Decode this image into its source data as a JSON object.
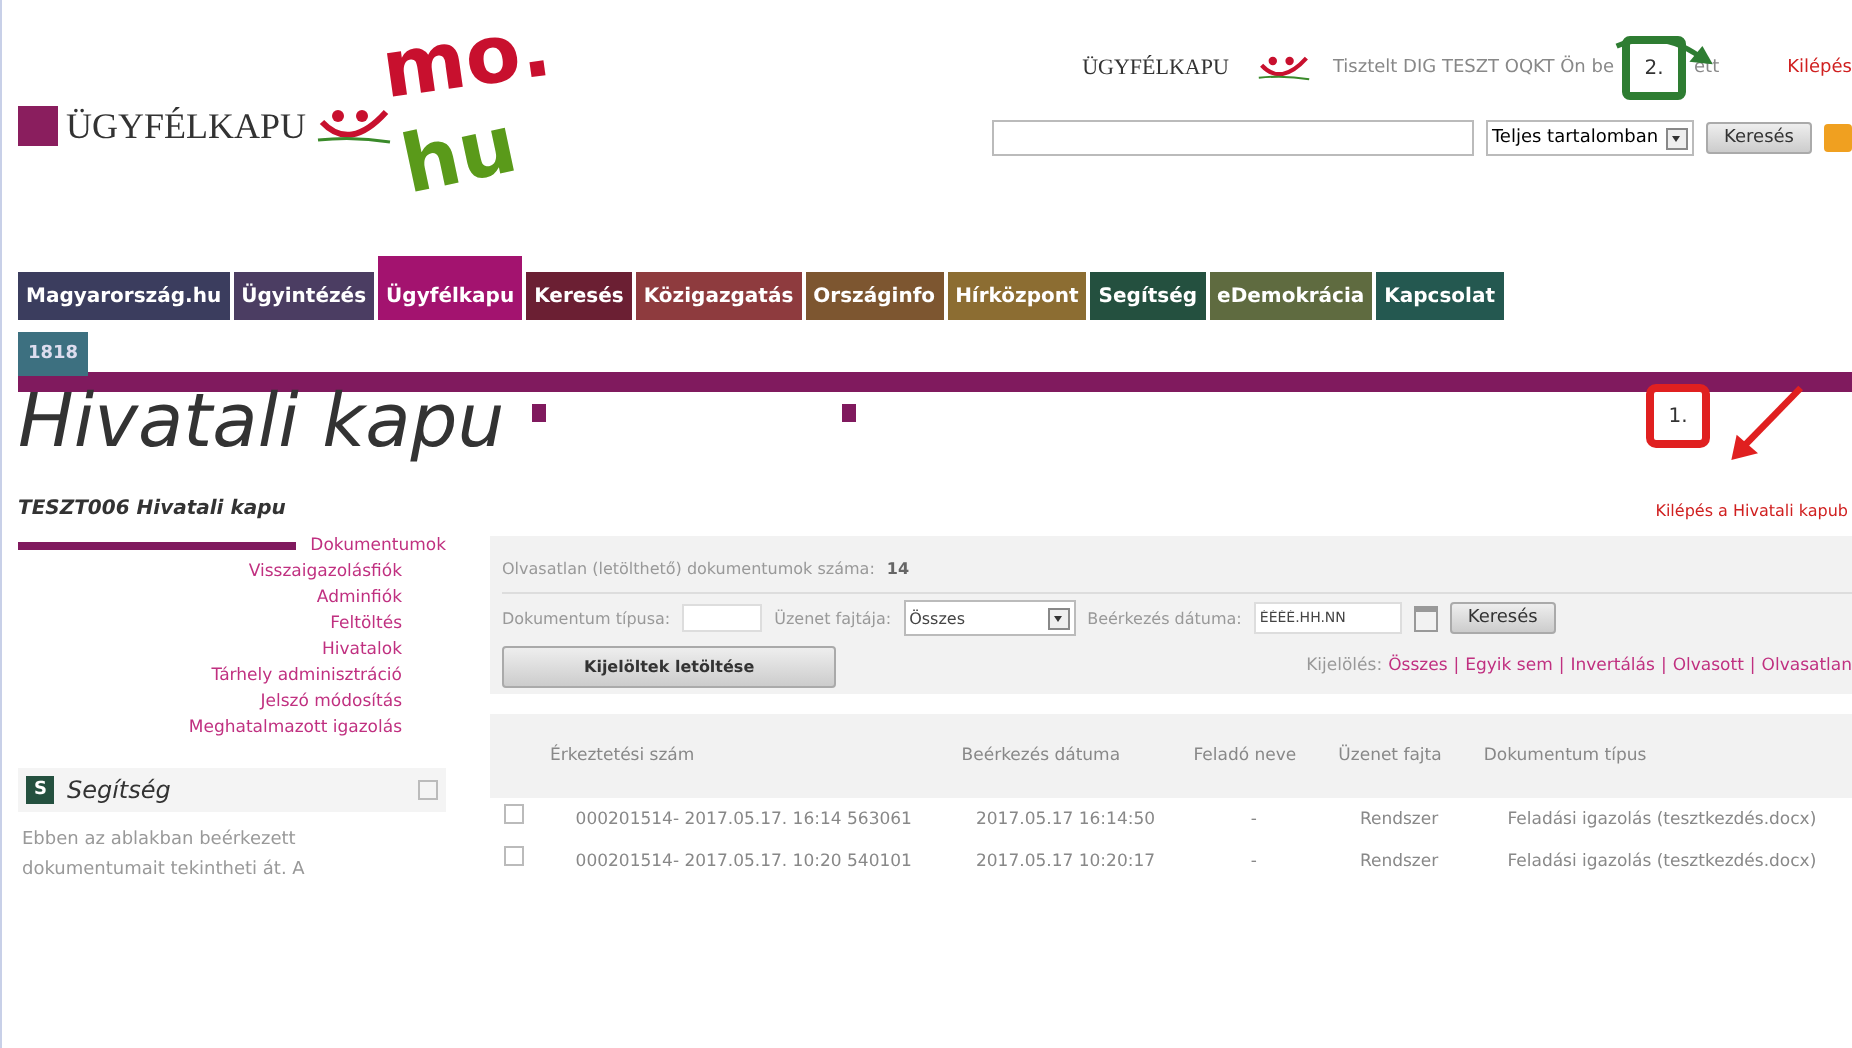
{
  "header": {
    "logo": "ÜGYFÉLKAPU",
    "logo_mark_top": "mo.",
    "logo_mark_bottom": "hu",
    "small_logo": "ÜGYFÉLKAPU",
    "greeting_start": "Tisztelt DIG TESZT OQKT Ön be",
    "greeting_end": "ett",
    "logout": "Kilépés",
    "search_scope": "Teljes tartalomban",
    "search_button": "Keresés"
  },
  "callouts": [
    {
      "label": "2.",
      "color": "#2e7d32"
    },
    {
      "label": "1.",
      "color": "#e02020"
    }
  ],
  "nav": [
    {
      "label": "Magyarország.hu",
      "color": "#3b3d5e",
      "selected": false
    },
    {
      "label": "Ügyintézés",
      "color": "#4b3d62",
      "selected": false
    },
    {
      "label": "Ügyfélkapu",
      "color": "#a3136f",
      "selected": true
    },
    {
      "label": "Keresés",
      "color": "#6b1f33",
      "selected": false
    },
    {
      "label": "Közigazgatás",
      "color": "#8e3b3e",
      "selected": false
    },
    {
      "label": "Országinfo",
      "color": "#7d5630",
      "selected": false
    },
    {
      "label": "Hírközpont",
      "color": "#8c6d32",
      "selected": false
    },
    {
      "label": "Segítség",
      "color": "#24503f",
      "selected": false
    },
    {
      "label": "eDemokrácia",
      "color": "#5f6b40",
      "selected": false
    },
    {
      "label": "Kapcsolat",
      "color": "#245850",
      "selected": false
    }
  ],
  "badge": "1818",
  "page_title": "Hivatali kapu",
  "subtitle": "TESZT006 Hivatali kapu",
  "exit_link": "Kilépés a Hivatali kapub",
  "sidebar": {
    "items": [
      {
        "label": "Dokumentumok",
        "selected": true
      },
      {
        "label": "Visszaigazolásfiók",
        "selected": false
      },
      {
        "label": "Adminfiók",
        "selected": false
      },
      {
        "label": "Feltöltés",
        "selected": false
      },
      {
        "label": "Hivatalok",
        "selected": false
      },
      {
        "label": "Tárhely adminisztráció",
        "selected": false
      },
      {
        "label": "Jelszó módosítás",
        "selected": false
      },
      {
        "label": "Meghatalmazott igazolás",
        "selected": false
      }
    ],
    "help": {
      "letter": "S",
      "title": "Segítség",
      "text": "Ebben az ablakban beérkezett dokumentumait tekintheti át. A"
    }
  },
  "main": {
    "unread_label": "Olvasatlan (letölthető) dokumentumok száma:",
    "unread_count": "14",
    "doc_type_label": "Dokumentum típusa:",
    "message_type_label": "Üzenet fajtája:",
    "message_type_value": "Összes",
    "date_label": "Beérkezés dátuma:",
    "date_value": "ÉÉÉÉ.HH.NN",
    "search_button": "Keresés",
    "download_button": "Kijelöltek letöltése",
    "selection_label": "Kijelölés:",
    "selection_separator": "|",
    "selection_links": [
      "Összes",
      "Egyik sem",
      "Invertálás",
      "Olvasott",
      "Olvasatlan"
    ]
  },
  "table": {
    "columns": [
      "Érkeztetési szám",
      "Beérkezés dátuma",
      "Feladó neve",
      "Üzenet fajta",
      "Dokumentum típus"
    ],
    "rows": [
      {
        "checked": false,
        "cells": [
          "000201514- 2017.05.17. 16:14 563061",
          "2017.05.17 16:14:50",
          "-",
          "Rendszer",
          "Feladási igazolás (tesztkezdés.docx)"
        ]
      },
      {
        "checked": false,
        "cells": [
          "000201514- 2017.05.17. 10:20 540101",
          "2017.05.17 10:20:17",
          "-",
          "Rendszer",
          "Feladási igazolás (tesztkezdés.docx)"
        ]
      }
    ]
  }
}
